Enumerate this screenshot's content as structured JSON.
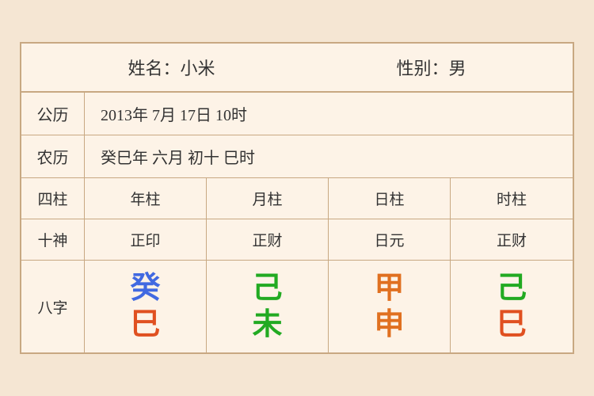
{
  "header": {
    "name_label": "姓名：小米",
    "gender_label": "性别：男"
  },
  "solar": {
    "label": "公历",
    "value": "2013年 7月 17日 10时"
  },
  "lunar": {
    "label": "农历",
    "value": "癸巳年 六月 初十 巳时"
  },
  "columns": {
    "header_label": "四柱",
    "year": "年柱",
    "month": "月柱",
    "day": "日柱",
    "hour": "时柱"
  },
  "shishen": {
    "label": "十神",
    "year": "正印",
    "month": "正财",
    "day": "日元",
    "hour": "正财"
  },
  "bazi": {
    "label": "八字",
    "year_top": "癸",
    "year_top_color": "#4169e1",
    "year_bottom": "巳",
    "year_bottom_color": "#e05020",
    "month_top": "己",
    "month_top_color": "#22aa22",
    "month_bottom": "未",
    "month_bottom_color": "#22aa22",
    "day_top": "甲",
    "day_top_color": "#e07020",
    "day_bottom": "申",
    "day_bottom_color": "#e07020",
    "hour_top": "己",
    "hour_top_color": "#22aa22",
    "hour_bottom": "巳",
    "hour_bottom_color": "#e05020"
  }
}
